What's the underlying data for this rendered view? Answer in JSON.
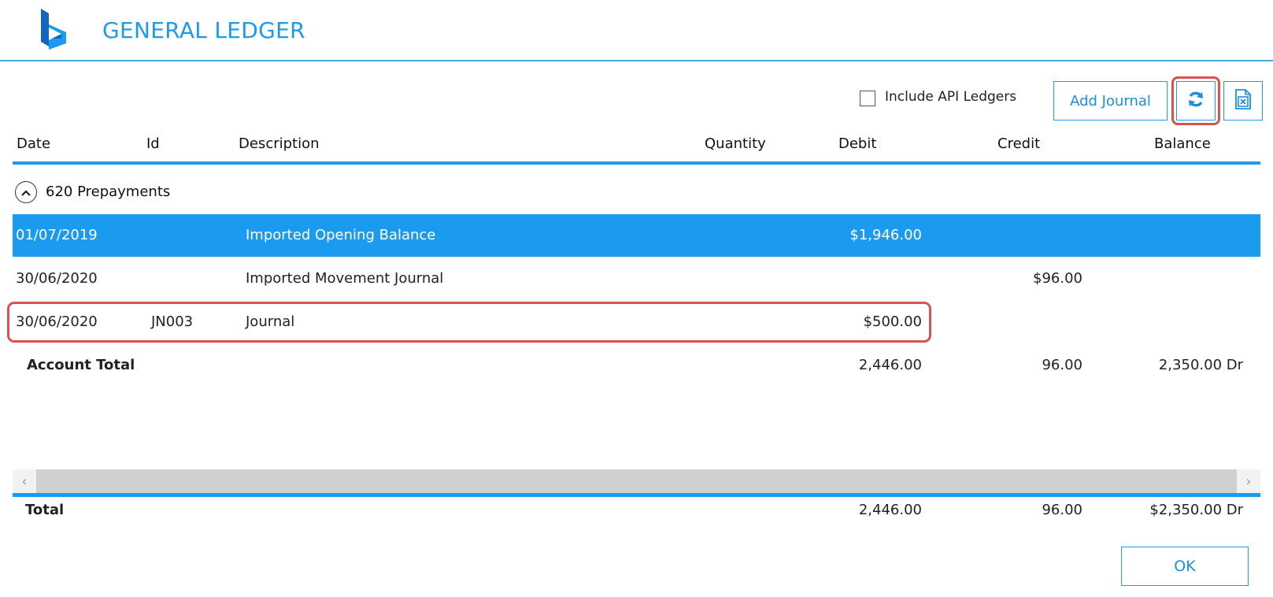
{
  "app": {
    "title": "GENERAL LEDGER"
  },
  "toolbar": {
    "include_api_label": "Include API Ledgers",
    "include_api_checked": false,
    "add_journal_label": "Add Journal",
    "refresh_icon": "refresh-icon",
    "export_icon": "excel-export-icon"
  },
  "columns": {
    "date": "Date",
    "id": "Id",
    "description": "Description",
    "quantity": "Quantity",
    "debit": "Debit",
    "credit": "Credit",
    "balance": "Balance"
  },
  "group": {
    "label": "620 Prepayments",
    "expanded": true
  },
  "rows": [
    {
      "date": "01/07/2019",
      "id": "",
      "description": "Imported Opening Balance",
      "quantity": "",
      "debit": "$1,946.00",
      "credit": "",
      "balance": "",
      "selected": true
    },
    {
      "date": "30/06/2020",
      "id": "",
      "description": "Imported Movement Journal",
      "quantity": "",
      "debit": "",
      "credit": "$96.00",
      "balance": "",
      "selected": false
    },
    {
      "date": "30/06/2020",
      "id": "JN003",
      "description": "Journal",
      "quantity": "",
      "debit": "$500.00",
      "credit": "",
      "balance": "",
      "selected": false
    }
  ],
  "account_total": {
    "label": "Account Total",
    "debit": "2,446.00",
    "credit": "96.00",
    "balance": "2,350.00 Dr"
  },
  "grand_total": {
    "label": "Total",
    "debit": "2,446.00",
    "credit": "96.00",
    "balance": "$2,350.00 Dr"
  },
  "footer": {
    "ok_label": "OK"
  },
  "colors": {
    "accent": "#1a9bf0",
    "highlight_outline": "#d9534f"
  }
}
